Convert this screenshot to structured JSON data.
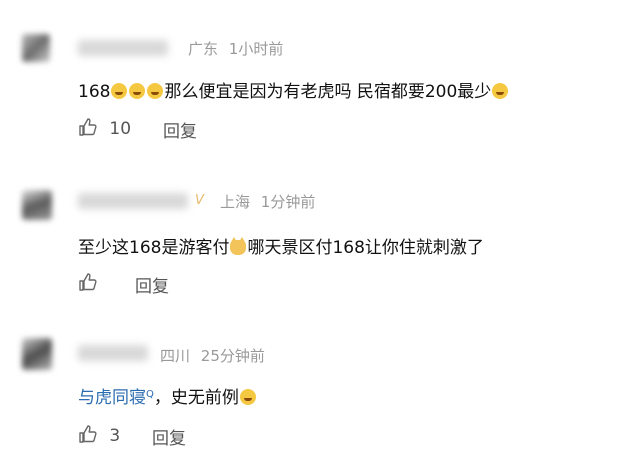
{
  "comments": [
    {
      "location": "广东",
      "time": "1小时前",
      "text_a": "168",
      "text_b": "那么便宜是因为有老虎吗 民宿都要200最少",
      "like_count": "10",
      "reply_label": "回复"
    },
    {
      "badge": "V",
      "location": "上海",
      "time": "1分钟前",
      "text_a": "至少这168是游客付",
      "text_b": "哪天景区付168让你住就刺激了",
      "like_count": "",
      "reply_label": "回复"
    },
    {
      "location": "四川",
      "time": "25分钟前",
      "link_text": "与虎同寝",
      "search_mark": "Q",
      "text_b": "，史无前例",
      "like_count": "3",
      "reply_label": "回复"
    }
  ],
  "colors": {
    "meta": "#9a9a9a",
    "link": "#2b6cb0",
    "badge": "#e8b96b"
  },
  "icons": [
    "thumb-up-icon",
    "laugh-emoji-icon",
    "cat-emoji-icon",
    "search-icon"
  ]
}
